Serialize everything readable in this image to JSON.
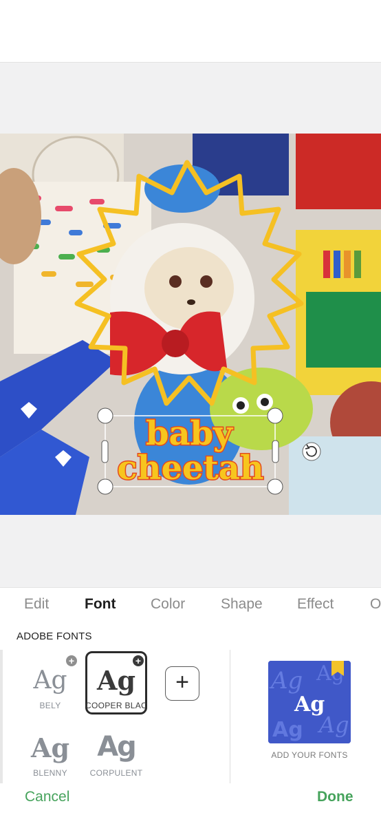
{
  "canvas": {
    "caption_line1": "baby",
    "caption_line2": "cheetah",
    "text_fill_color": "#f7c51e",
    "text_stroke_color": "#e34a1f",
    "starburst_color": "#f5c023",
    "selection_handle_color": "#ffffff"
  },
  "tabs": [
    {
      "label": "Edit",
      "active": false
    },
    {
      "label": "Font",
      "active": true
    },
    {
      "label": "Color",
      "active": false
    },
    {
      "label": "Shape",
      "active": false
    },
    {
      "label": "Effect",
      "active": false
    },
    {
      "label": "O",
      "active": false
    }
  ],
  "fonts": {
    "section_title": "ADOBE FONTS",
    "preview_glyph": "Ag",
    "items": [
      {
        "name": "BELY",
        "selected": false,
        "downloadable": true
      },
      {
        "name": "COOPER BLAC",
        "selected": true,
        "downloadable": true
      },
      {
        "name": "BLENNY",
        "selected": false,
        "downloadable": false
      },
      {
        "name": "CORPULENT",
        "selected": false,
        "downloadable": false
      }
    ],
    "add_button_symbol": "+",
    "badge_symbol": "+",
    "add_your_fonts_label": "ADD YOUR FONTS"
  },
  "footer": {
    "cancel_label": "Cancel",
    "done_label": "Done",
    "accent_color": "#46a35c"
  }
}
